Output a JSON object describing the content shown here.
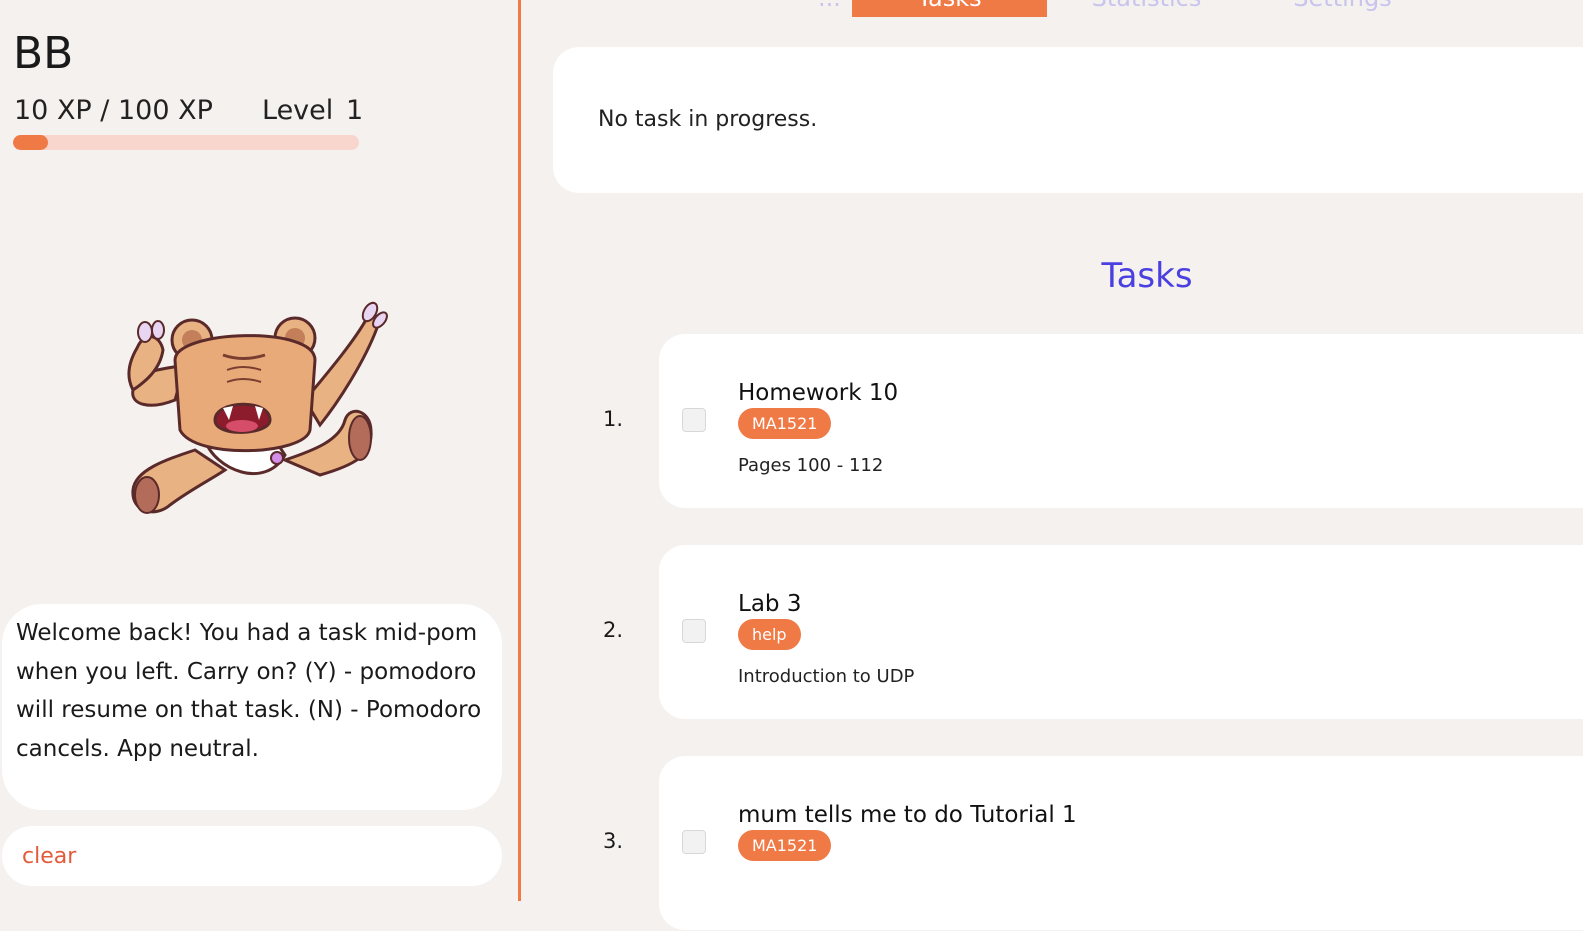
{
  "user": {
    "name": "BB",
    "xp_text": "10 XP / 100 XP",
    "level_label": "Level",
    "level_value": "1",
    "xp_progress": 0.1
  },
  "mascot": {
    "icon": "bear-mascot-icon"
  },
  "speech": {
    "message": "Welcome back! You had a task mid-pom when you left. Carry on? (Y) - pomodoro will resume on that task. (N) - Pomodoro cancels. App neutral."
  },
  "command": {
    "value": "clear"
  },
  "tabs": [
    {
      "label": "...",
      "active": false
    },
    {
      "label": "Tasks",
      "active": true
    },
    {
      "label": "Statistics",
      "active": false
    },
    {
      "label": "Settings",
      "active": false
    }
  ],
  "status": {
    "text": "No task in progress."
  },
  "tasks_heading": "Tasks",
  "tasks": [
    {
      "number": "1.",
      "title": "Homework 10",
      "tag": "MA1521",
      "description": "Pages 100 - 112"
    },
    {
      "number": "2.",
      "title": "Lab 3",
      "tag": "help",
      "description": "Introduction to UDP"
    },
    {
      "number": "3.",
      "title": "mum tells me to do Tutorial 1",
      "tag": "MA1521",
      "description": ""
    }
  ],
  "colors": {
    "accent": "#f07a45",
    "heading": "#4a3fe0",
    "background": "#f5f1ef",
    "xp_track": "#f8d6cd",
    "inactive_tab": "#c9c4ee"
  }
}
